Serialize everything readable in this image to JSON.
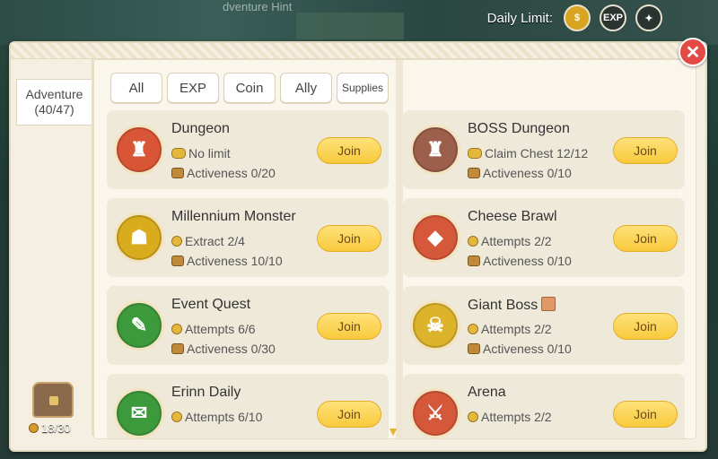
{
  "background": {
    "hint_text": "dventure Hint"
  },
  "daily_limit": {
    "label": "Daily Limit:",
    "buttons": [
      {
        "name": "coin",
        "text": "$"
      },
      {
        "name": "exp",
        "text": "EXP"
      },
      {
        "name": "ally",
        "text": "✦"
      }
    ]
  },
  "close_label": "✕",
  "side_tab": {
    "line1": "Adventure",
    "line2": "(40/47)"
  },
  "chest": {
    "count": "18/30"
  },
  "tabs": [
    "All",
    "EXP",
    "Coin",
    "Ally",
    "Supplies"
  ],
  "cards": [
    {
      "title": "Dungeon",
      "line1": "No limit",
      "line2": "Activeness 0/20",
      "join": "Join",
      "icon": "dungeon-icon",
      "color": "#d85535"
    },
    {
      "title": "BOSS Dungeon",
      "line1": "Claim Chest 12/12",
      "line2": "Activeness 0/10",
      "join": "Join",
      "icon": "boss-dungeon-icon",
      "color": "#9b5f4b"
    },
    {
      "title": "Millennium Monster",
      "line1": "Extract 2/4",
      "line2": "Activeness 10/10",
      "join": "Join",
      "icon": "millennium-monster-icon",
      "color": "#d9ac1d"
    },
    {
      "title": "Cheese Brawl",
      "line1": "Attempts 2/2",
      "line2": "Activeness 0/10",
      "join": "Join",
      "icon": "cheese-brawl-icon",
      "color": "#d5583a"
    },
    {
      "title": "Event Quest",
      "line1": "Attempts 6/6",
      "line2": "Activeness 0/30",
      "join": "Join",
      "icon": "event-quest-icon",
      "color": "#3c9a3c"
    },
    {
      "title": "Giant Boss",
      "line1": "Attempts 2/2",
      "line2": "Activeness 0/10",
      "join": "Join",
      "icon": "giant-boss-icon",
      "color": "#dcb32a"
    },
    {
      "title": "Erinn Daily",
      "line1": "Attempts 6/10",
      "line2": "",
      "join": "Join",
      "icon": "erinn-daily-icon",
      "color": "#3c9a3c"
    },
    {
      "title": "Arena",
      "line1": "Attempts 2/2",
      "line2": "",
      "join": "Join",
      "icon": "arena-icon",
      "color": "#d5583a"
    }
  ]
}
